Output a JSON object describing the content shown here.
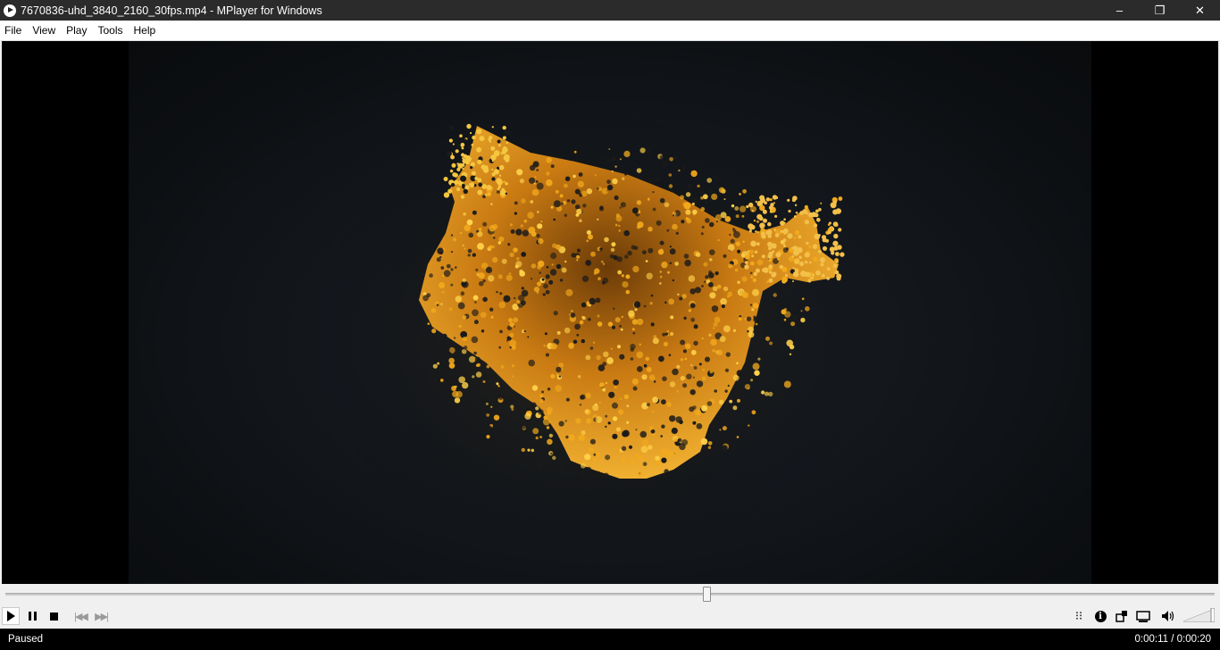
{
  "window": {
    "title": "7670836-uhd_3840_2160_30fps.mp4 - MPlayer for Windows",
    "controls": {
      "minimize": "–",
      "maximize": "❐",
      "close": "✕"
    }
  },
  "menu": [
    "File",
    "View",
    "Play",
    "Tools",
    "Help"
  ],
  "player": {
    "seek_position": 0.58,
    "volume_level": 1.0,
    "icons": [
      "play-icon",
      "pause-icon",
      "stop-icon",
      "previous-icon",
      "next-icon",
      "playlist-icon",
      "info-icon",
      "fullscreen-icon",
      "display-icon",
      "volume-icon"
    ]
  },
  "status": {
    "state": "Paused",
    "time": "0:00:11 / 0:00:20"
  },
  "colors": {
    "titlebar": "#2b2b2b",
    "statusbar": "#000000",
    "particles_gold": "#f2a91c",
    "particles_dark": "#1a1a1a"
  }
}
